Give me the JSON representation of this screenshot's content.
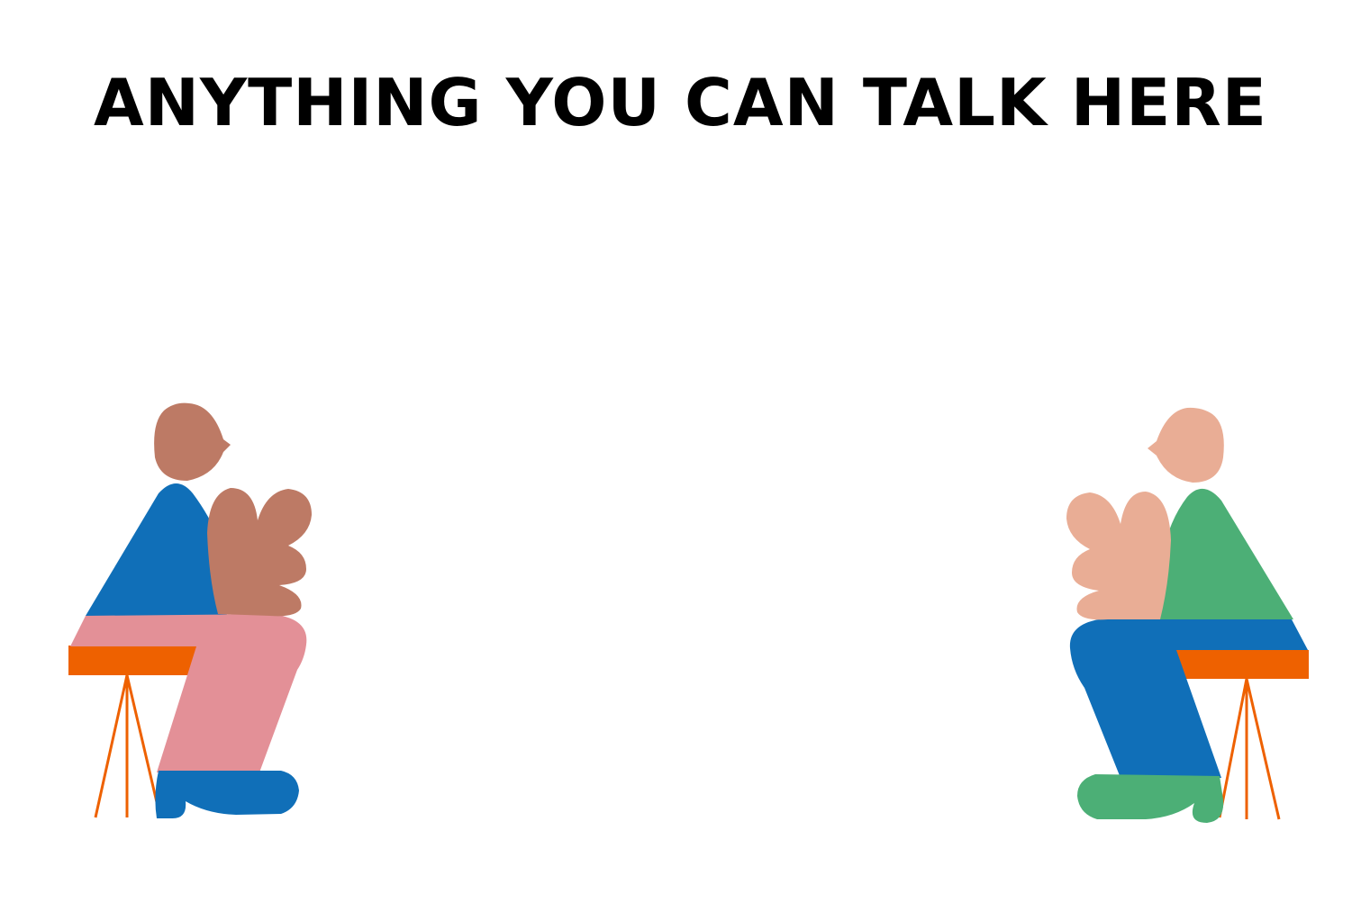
{
  "title": "ANYTHING YOU CAN TALK HERE",
  "colors": {
    "background": "#ffffff",
    "title": "#000000",
    "stool": "#ee6100",
    "left_person_skin": "#bd7a65",
    "left_person_shirt": "#106fb8",
    "left_person_pants": "#e39097",
    "left_person_shoes": "#106fb8",
    "right_person_skin": "#e9ad95",
    "right_person_shirt": "#4caf76",
    "right_person_pants": "#106fb8",
    "right_person_shoes": "#4caf76"
  },
  "illustration": {
    "figures": [
      "left-seated-person",
      "right-seated-person"
    ],
    "props": [
      "left-stool",
      "right-stool"
    ]
  }
}
